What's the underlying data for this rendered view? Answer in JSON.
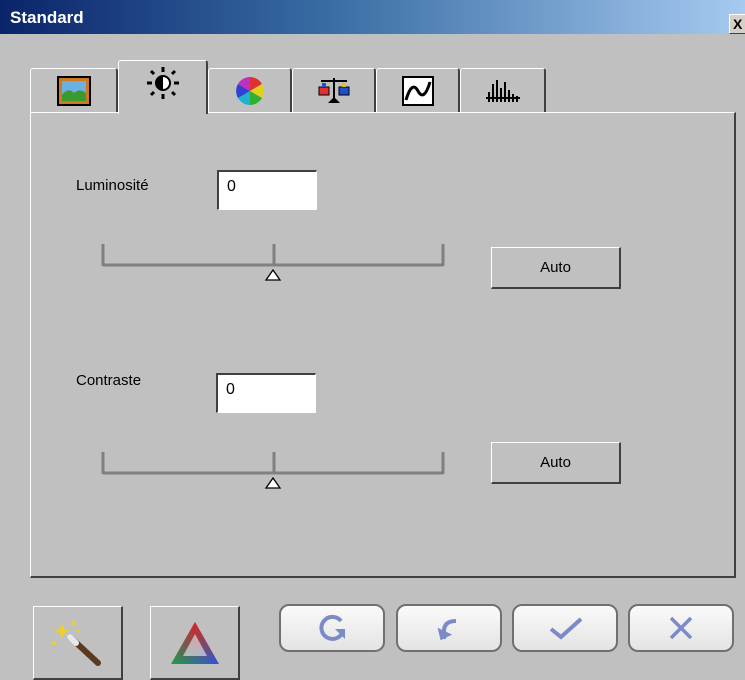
{
  "window": {
    "title": "Standard",
    "close_glyph": "X"
  },
  "tabs": [
    {
      "name": "image",
      "icon": "landscape-picture-icon",
      "active": false
    },
    {
      "name": "brightness",
      "icon": "sun-icon",
      "active": true
    },
    {
      "name": "color",
      "icon": "color-wheel-icon",
      "active": false
    },
    {
      "name": "balance",
      "icon": "balance-scale-icon",
      "active": false
    },
    {
      "name": "curve",
      "icon": "tone-curve-icon",
      "active": false
    },
    {
      "name": "histogram",
      "icon": "histogram-icon",
      "active": false
    }
  ],
  "brightness": {
    "label": "Luminosité",
    "value": "0",
    "slider_fraction": 0.5,
    "auto_label": "Auto"
  },
  "contrast": {
    "label": "Contraste",
    "value": "0",
    "slider_fraction": 0.5,
    "auto_label": "Auto"
  },
  "toolbar": {
    "left": [
      {
        "icon": "magic-wand-icon"
      },
      {
        "icon": "rgb-triangle-icon"
      }
    ],
    "right": [
      {
        "icon": "refresh-icon"
      },
      {
        "icon": "undo-icon"
      },
      {
        "icon": "checkmark-icon"
      },
      {
        "icon": "cancel-x-icon"
      }
    ]
  },
  "colors": {
    "face": "#c0c0c0",
    "title_start": "#0a246a",
    "accent_blue": "#7c8ac8"
  }
}
